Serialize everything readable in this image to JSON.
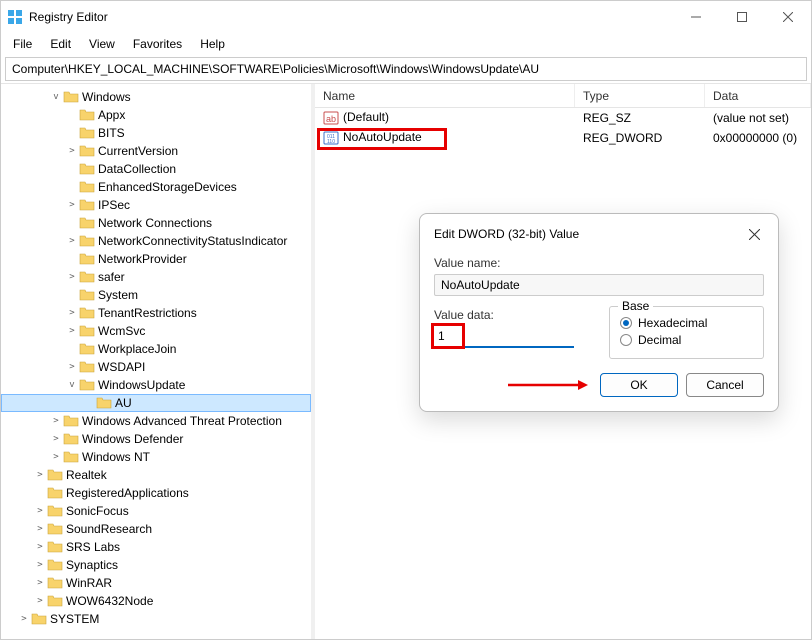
{
  "app": {
    "title": "Registry Editor"
  },
  "menus": [
    "File",
    "Edit",
    "View",
    "Favorites",
    "Help"
  ],
  "address": "Computer\\HKEY_LOCAL_MACHINE\\SOFTWARE\\Policies\\Microsoft\\Windows\\WindowsUpdate\\AU",
  "columns": {
    "name": "Name",
    "type": "Type",
    "data": "Data"
  },
  "values": [
    {
      "icon": "string",
      "name": "(Default)",
      "type": "REG_SZ",
      "data": "(value not set)",
      "highlight": false
    },
    {
      "icon": "dword",
      "name": "NoAutoUpdate",
      "type": "REG_DWORD",
      "data": "0x00000000 (0)",
      "highlight": true
    }
  ],
  "tree": {
    "d0": [
      {
        "label": "Windows",
        "expanded": true,
        "children": "d1"
      }
    ],
    "d1": [
      {
        "label": "Appx"
      },
      {
        "label": "BITS"
      },
      {
        "label": "CurrentVersion",
        "caret": ">"
      },
      {
        "label": "DataCollection"
      },
      {
        "label": "EnhancedStorageDevices"
      },
      {
        "label": "IPSec",
        "caret": ">"
      },
      {
        "label": "Network Connections"
      },
      {
        "label": "NetworkConnectivityStatusIndicator",
        "caret": ">"
      },
      {
        "label": "NetworkProvider"
      },
      {
        "label": "safer",
        "caret": ">"
      },
      {
        "label": "System"
      },
      {
        "label": "TenantRestrictions",
        "caret": ">"
      },
      {
        "label": "WcmSvc",
        "caret": ">"
      },
      {
        "label": "WorkplaceJoin"
      },
      {
        "label": "WSDAPI",
        "caret": ">"
      },
      {
        "label": "WindowsUpdate",
        "expanded": true,
        "children": "d2"
      }
    ],
    "d2": [
      {
        "label": "AU",
        "selected": true
      }
    ],
    "d0b": [
      {
        "label": "Windows Advanced Threat Protection",
        "caret": ">"
      },
      {
        "label": "Windows Defender",
        "caret": ">"
      },
      {
        "label": "Windows NT",
        "caret": ">"
      }
    ],
    "d_neg1": [
      {
        "label": "Realtek",
        "caret": ">"
      },
      {
        "label": "RegisteredApplications"
      },
      {
        "label": "SonicFocus",
        "caret": ">"
      },
      {
        "label": "SoundResearch",
        "caret": ">"
      },
      {
        "label": "SRS Labs",
        "caret": ">"
      },
      {
        "label": "Synaptics",
        "caret": ">"
      },
      {
        "label": "WinRAR",
        "caret": ">"
      },
      {
        "label": "WOW6432Node",
        "caret": ">"
      }
    ],
    "d_neg2": [
      {
        "label": "SYSTEM",
        "caret": ">"
      }
    ]
  },
  "dialog": {
    "title": "Edit DWORD (32-bit) Value",
    "name_label": "Value name:",
    "name_value": "NoAutoUpdate",
    "data_label": "Value data:",
    "data_value": "1",
    "base_label": "Base",
    "hex_label": "Hexadecimal",
    "dec_label": "Decimal",
    "ok": "OK",
    "cancel": "Cancel"
  }
}
